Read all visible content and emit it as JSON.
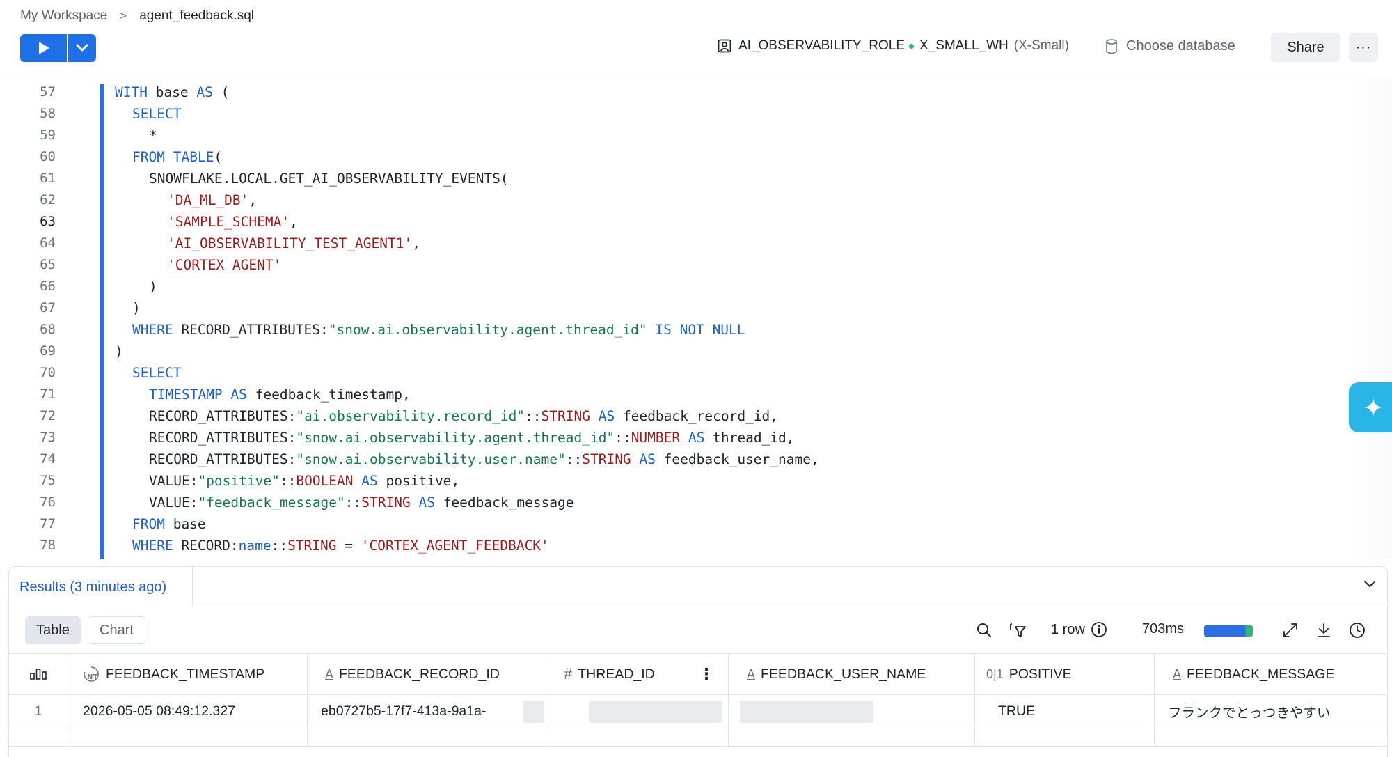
{
  "breadcrumb": {
    "workspace": "My Workspace",
    "separator": ">",
    "file": "agent_feedback.sql"
  },
  "toolbar": {
    "role": "AI_OBSERVABILITY_ROLE",
    "warehouse": "X_SMALL_WH",
    "warehouse_size": "(X-Small)",
    "database_placeholder": "Choose database",
    "share_label": "Share",
    "more_label": "···"
  },
  "editor": {
    "line_numbers": [
      "57",
      "58",
      "59",
      "60",
      "61",
      "62",
      "63",
      "64",
      "65",
      "66",
      "67",
      "68",
      "69",
      "70",
      "71",
      "72",
      "73",
      "74",
      "75",
      "76",
      "77",
      "78"
    ],
    "active_line": "63"
  },
  "code": {
    "l57": [
      "WITH",
      " base ",
      "AS",
      " ("
    ],
    "l58": [
      "SELECT"
    ],
    "l59": [
      "*"
    ],
    "l60": [
      "FROM",
      " ",
      "TABLE",
      "("
    ],
    "l61": [
      "SNOWFLAKE.LOCAL.GET_AI_OBSERVABILITY_EVENTS("
    ],
    "l62": [
      "'DA_ML_DB'",
      ","
    ],
    "l63": [
      "'SAMPLE_SCHEMA'",
      ","
    ],
    "l64": [
      "'AI_OBSERVABILITY_TEST_AGENT1'",
      ","
    ],
    "l65": [
      "'CORTEX AGENT'"
    ],
    "l66": [
      ")"
    ],
    "l67": [
      ")"
    ],
    "l68": [
      "WHERE",
      " RECORD_ATTRIBUTES:",
      "\"snow.ai.observability.agent.thread_id\"",
      " ",
      "IS NOT NULL"
    ],
    "l69": [
      ")"
    ],
    "l70": [
      "SELECT"
    ],
    "l71": [
      "TIMESTAMP",
      " ",
      "AS",
      " feedback_timestamp,"
    ],
    "l72": [
      "RECORD_ATTRIBUTES:",
      "\"ai.observability.record_id\"",
      "::",
      "STRING",
      " ",
      "AS",
      " feedback_record_id,"
    ],
    "l73": [
      "RECORD_ATTRIBUTES:",
      "\"snow.ai.observability.agent.thread_id\"",
      "::",
      "NUMBER",
      " ",
      "AS",
      " thread_id,"
    ],
    "l74": [
      "RECORD_ATTRIBUTES:",
      "\"snow.ai.observability.user.name\"",
      "::",
      "STRING",
      " ",
      "AS",
      " feedback_user_name,"
    ],
    "l75": [
      "VALUE:",
      "\"positive\"",
      "::",
      "BOOLEAN",
      " ",
      "AS",
      " positive,"
    ],
    "l76": [
      "VALUE:",
      "\"feedback_message\"",
      "::",
      "STRING",
      " ",
      "AS",
      " feedback_message"
    ],
    "l77": [
      "FROM",
      " base"
    ],
    "l78": [
      "WHERE",
      " RECORD:",
      "name",
      "::",
      "STRING",
      " = ",
      "'CORTEX_AGENT_FEEDBACK'"
    ]
  },
  "results": {
    "tab_label": "Results (3 minutes ago)",
    "view_table": "Table",
    "view_chart": "Chart",
    "row_count": "1 row",
    "duration": "703ms",
    "progress": 1.0,
    "columns": [
      {
        "type_icon": "timestamp-icon",
        "type_glyph": "NT",
        "name": "FEEDBACK_TIMESTAMP"
      },
      {
        "type_icon": "text-type-icon",
        "type_glyph": "A",
        "name": "FEEDBACK_RECORD_ID"
      },
      {
        "type_icon": "number-type-icon",
        "type_glyph": "#",
        "name": "THREAD_ID"
      },
      {
        "type_icon": "text-type-icon",
        "type_glyph": "A",
        "name": "FEEDBACK_USER_NAME"
      },
      {
        "type_icon": "boolean-type-icon",
        "type_glyph": "0|1",
        "name": "POSITIVE"
      },
      {
        "type_icon": "text-type-icon",
        "type_glyph": "A",
        "name": "FEEDBACK_MESSAGE"
      }
    ],
    "rows": [
      {
        "index": "1",
        "cells": [
          "2026-05-05 08:49:12.327",
          "eb0727b5-17f7-413a-9a1a-",
          "",
          "",
          "TRUE",
          "フランクでとっつきやすい"
        ]
      }
    ]
  },
  "colors": {
    "accent": "#1f6fe5",
    "keyword": "#1f5fc8",
    "string": "#9b1c1c",
    "json_key": "#137a53",
    "ai_button": "#29b5e8"
  }
}
